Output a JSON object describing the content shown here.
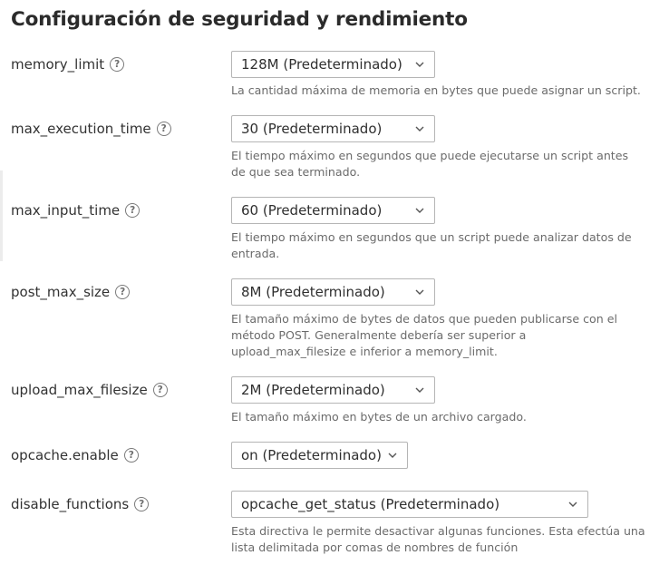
{
  "page": {
    "title": "Configuración de seguridad y rendimiento"
  },
  "settings": [
    {
      "label": "memory_limit",
      "value": "128M (Predeterminado)",
      "description": "La cantidad máxima de memoria en bytes que puede asignar un script."
    },
    {
      "label": "max_execution_time",
      "value": "30 (Predeterminado)",
      "description": "El tiempo máximo en segundos que puede ejecutarse un script antes de que sea terminado."
    },
    {
      "label": "max_input_time",
      "value": "60 (Predeterminado)",
      "description": "El tiempo máximo en segundos que un script puede analizar datos de entrada."
    },
    {
      "label": "post_max_size",
      "value": "8M (Predeterminado)",
      "description": "El tamaño máximo de bytes de datos que pueden publicarse con el método POST. Generalmente debería ser superior a upload_max_filesize e inferior a memory_limit."
    },
    {
      "label": "upload_max_filesize",
      "value": "2M (Predeterminado)",
      "description": "El tamaño máximo en bytes de un archivo cargado."
    },
    {
      "label": "opcache.enable",
      "value": "on (Predeterminado)",
      "description": ""
    },
    {
      "label": "disable_functions",
      "value": "opcache_get_status (Predeterminado)",
      "description": "Esta directiva le permite desactivar algunas funciones. Esta efectúa una lista delimitada por comas de nombres de función"
    }
  ],
  "icons": {
    "help": "help-circle-icon",
    "help_glyph": "?",
    "dropdown": "chevron-down-icon"
  },
  "colors": {
    "text": "#323232",
    "description": "#6b6b6b",
    "border": "#b5b5b5",
    "icon": "#7a7a7a"
  }
}
